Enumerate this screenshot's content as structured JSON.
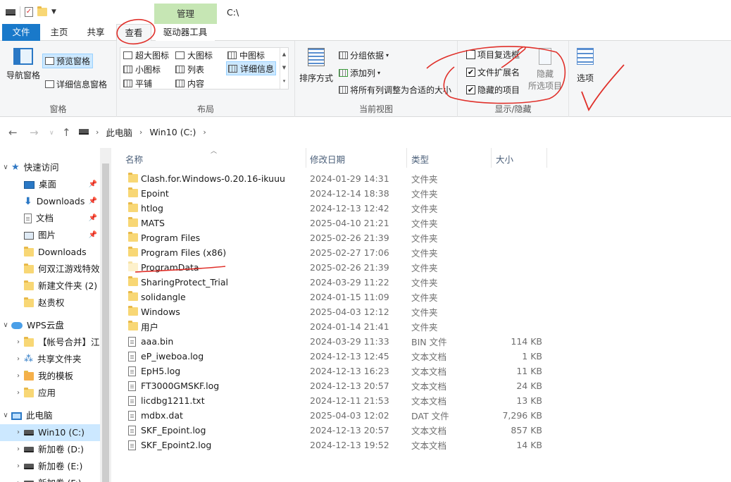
{
  "window": {
    "title_path": "C:\\",
    "manage_tab": "管理"
  },
  "tabs": {
    "file": "文件",
    "home": "主页",
    "share": "共享",
    "view": "查看",
    "drive_tools": "驱动器工具"
  },
  "ribbon": {
    "pane_group": {
      "nav_pane": "导航窗格",
      "preview_pane": "预览窗格",
      "details_pane": "详细信息窗格",
      "label": "窗格"
    },
    "layout_group": {
      "items": [
        "超大图标",
        "大图标",
        "中图标",
        "小图标",
        "列表",
        "详细信息",
        "平铺",
        "内容"
      ],
      "label": "布局"
    },
    "current_view_group": {
      "sort_by": "排序方式",
      "group_by": "分组依据",
      "add_columns": "添加列",
      "size_columns": "将所有列调整为合适的大小",
      "label": "当前视图"
    },
    "show_hide_group": {
      "item_checkboxes": "项目复选框",
      "file_extensions": "文件扩展名",
      "hidden_items": "隐藏的项目",
      "hide_selected_line1": "隐藏",
      "hide_selected_line2": "所选项目",
      "label": "显示/隐藏",
      "item_checkboxes_checked": false,
      "file_extensions_checked": true,
      "hidden_items_checked": true
    },
    "options": "选项"
  },
  "address": {
    "crumbs": [
      "此电脑",
      "Win10 (C:)"
    ]
  },
  "nav": {
    "quick_access": "快速访问",
    "items": [
      {
        "label": "桌面",
        "pinned": true
      },
      {
        "label": "Downloads",
        "pinned": true
      },
      {
        "label": "文档",
        "pinned": true
      },
      {
        "label": "图片",
        "pinned": true
      },
      {
        "label": "Downloads",
        "pinned": false
      },
      {
        "label": "何双江游戏特效",
        "pinned": false
      },
      {
        "label": "新建文件夹 (2)",
        "pinned": false
      },
      {
        "label": "赵贵权",
        "pinned": false
      }
    ],
    "wps_cloud": "WPS云盘",
    "wps_items": [
      "【帐号合并】江",
      "共享文件夹",
      "我的模板",
      "应用"
    ],
    "this_pc": "此电脑",
    "drives": [
      "Win10 (C:)",
      "新加卷 (D:)",
      "新加卷 (E:)",
      "新加卷 (F:)"
    ]
  },
  "columns": {
    "name": "名称",
    "date": "修改日期",
    "type": "类型",
    "size": "大小"
  },
  "files": [
    {
      "name": "Clash.for.Windows-0.20.16-ikuuu",
      "date": "2024-01-29 14:31",
      "type": "文件夹",
      "size": "",
      "kind": "folder"
    },
    {
      "name": "Epoint",
      "date": "2024-12-14 18:38",
      "type": "文件夹",
      "size": "",
      "kind": "folder"
    },
    {
      "name": "htlog",
      "date": "2024-12-13 12:42",
      "type": "文件夹",
      "size": "",
      "kind": "folder"
    },
    {
      "name": "MATS",
      "date": "2025-04-10 21:21",
      "type": "文件夹",
      "size": "",
      "kind": "folder"
    },
    {
      "name": "Program Files",
      "date": "2025-02-26 21:39",
      "type": "文件夹",
      "size": "",
      "kind": "folder"
    },
    {
      "name": "Program Files (x86)",
      "date": "2025-02-27 17:06",
      "type": "文件夹",
      "size": "",
      "kind": "folder"
    },
    {
      "name": "ProgramData",
      "date": "2025-02-26 21:39",
      "type": "文件夹",
      "size": "",
      "kind": "hidden-folder"
    },
    {
      "name": "SharingProtect_Trial",
      "date": "2024-03-29 11:22",
      "type": "文件夹",
      "size": "",
      "kind": "folder"
    },
    {
      "name": "solidangle",
      "date": "2024-01-15 11:09",
      "type": "文件夹",
      "size": "",
      "kind": "folder"
    },
    {
      "name": "Windows",
      "date": "2025-04-03 12:12",
      "type": "文件夹",
      "size": "",
      "kind": "folder"
    },
    {
      "name": "用户",
      "date": "2024-01-14 21:41",
      "type": "文件夹",
      "size": "",
      "kind": "folder"
    },
    {
      "name": "aaa.bin",
      "date": "2024-03-29 11:33",
      "type": "BIN 文件",
      "size": "114 KB",
      "kind": "file"
    },
    {
      "name": "eP_iweboa.log",
      "date": "2024-12-13 12:45",
      "type": "文本文档",
      "size": "1 KB",
      "kind": "file"
    },
    {
      "name": "EpH5.log",
      "date": "2024-12-13 16:23",
      "type": "文本文档",
      "size": "11 KB",
      "kind": "file"
    },
    {
      "name": "FT3000GMSKF.log",
      "date": "2024-12-13 20:57",
      "type": "文本文档",
      "size": "24 KB",
      "kind": "file"
    },
    {
      "name": "licdbg1211.txt",
      "date": "2024-12-11 21:53",
      "type": "文本文档",
      "size": "13 KB",
      "kind": "file"
    },
    {
      "name": "mdbx.dat",
      "date": "2025-04-03 12:02",
      "type": "DAT 文件",
      "size": "7,296 KB",
      "kind": "file"
    },
    {
      "name": "SKF_Epoint.log",
      "date": "2024-12-13 20:57",
      "type": "文本文档",
      "size": "857 KB",
      "kind": "file"
    },
    {
      "name": "SKF_Epoint2.log",
      "date": "2024-12-13 19:52",
      "type": "文本文档",
      "size": "14 KB",
      "kind": "file"
    }
  ],
  "colors": {
    "accent": "#1979ca",
    "selection": "#cce8ff",
    "annotation": "#e0302a",
    "manage_tab": "#c6e6b4"
  }
}
